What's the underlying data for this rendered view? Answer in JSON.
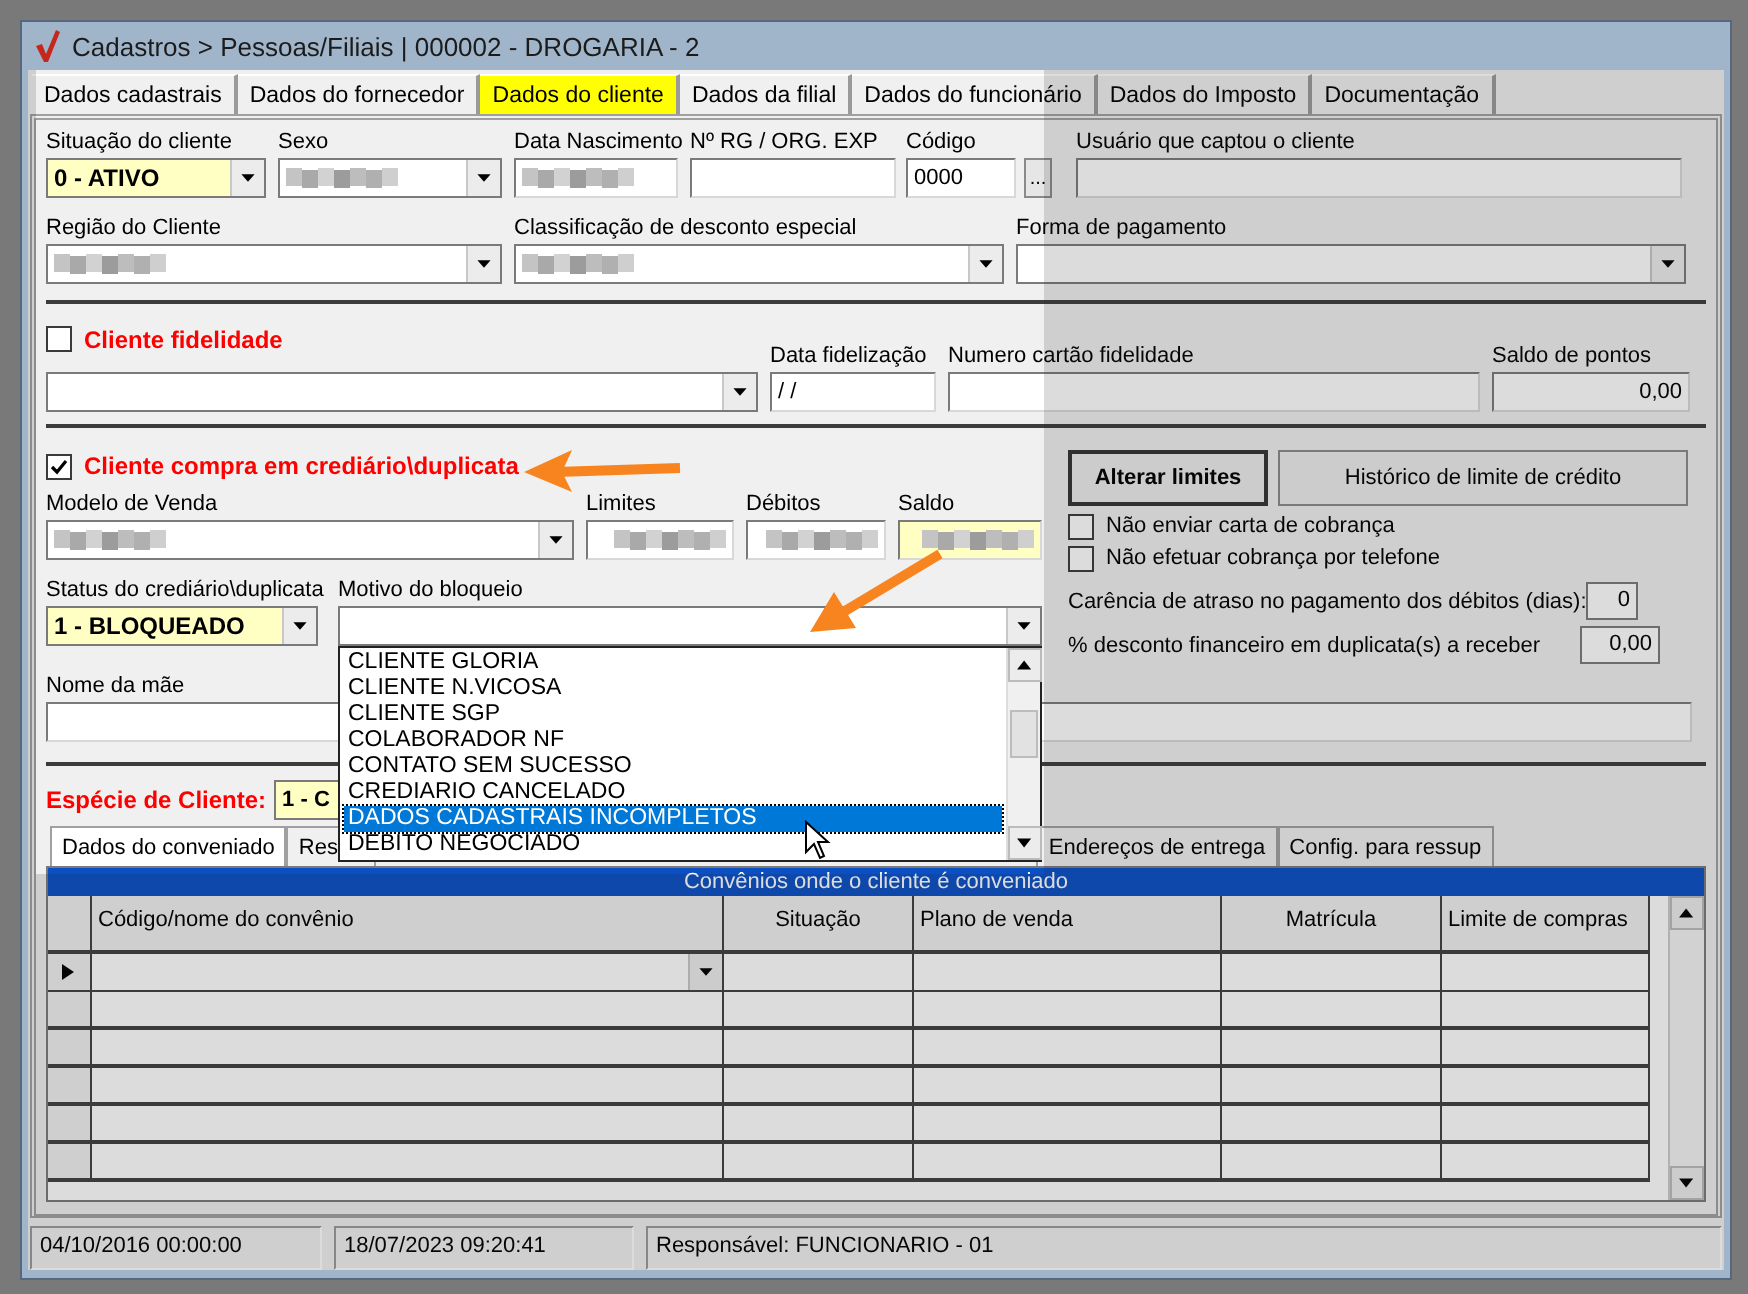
{
  "window": {
    "title": "Cadastros > Pessoas/Filiais | 000002 - DROGARIA - 2"
  },
  "tabs": [
    {
      "label": "Dados cadastrais",
      "selected": false
    },
    {
      "label": "Dados do fornecedor",
      "selected": false
    },
    {
      "label": "Dados do cliente",
      "selected": true
    },
    {
      "label": "Dados da filial",
      "selected": false
    },
    {
      "label": "Dados do funcionário",
      "selected": false
    },
    {
      "label": "Dados do Imposto",
      "selected": false
    },
    {
      "label": "Documentação",
      "selected": false
    }
  ],
  "client_rows": [
    [
      {
        "label": "Situação do cliente",
        "kind": "combo",
        "value": "0 - ATIVO",
        "highlighted": true
      },
      {
        "label": "Sexo",
        "kind": "combo",
        "redacted": true
      },
      {
        "label": "Data Nascimento",
        "kind": "text",
        "redacted": true
      },
      {
        "label": "Nº RG / ORG. EXP",
        "kind": "text"
      },
      {
        "label": "Código",
        "kind": "text",
        "value": "0000"
      },
      {
        "kind": "button",
        "value": "..."
      },
      {
        "label": "Usuário que captou o cliente",
        "kind": "text"
      }
    ],
    [
      {
        "label": "Região do Cliente",
        "kind": "combo",
        "redacted": true
      },
      {
        "label": "Classificação de desconto especial",
        "kind": "combo",
        "redacted": true
      },
      {
        "label": "Forma de pagamento",
        "kind": "combo"
      }
    ]
  ],
  "loyalty": {
    "label": "Cliente fidelidade",
    "checked": false,
    "fields": [
      {
        "kind": "combo"
      },
      {
        "label": "Data fidelização",
        "kind": "text",
        "value": "/ /"
      },
      {
        "label": "Numero cartão fidelidade",
        "kind": "text"
      },
      {
        "label": "Saldo de pontos",
        "kind": "number",
        "value": "0,00"
      }
    ]
  },
  "credit": {
    "label": "Cliente compra em crediário\\duplicata",
    "checked": true,
    "rows": [
      [
        {
          "label": "Modelo de Venda",
          "kind": "combo",
          "redacted": true
        },
        {
          "label": "Limites",
          "kind": "number",
          "redacted": true
        },
        {
          "label": "Débitos",
          "kind": "number",
          "redacted": true
        },
        {
          "label": "Saldo",
          "kind": "number",
          "redacted": true,
          "highlighted": true
        }
      ],
      [
        {
          "label": "Status do crediário\\duplicata",
          "kind": "combo",
          "value": "1 - BLOQUEADO",
          "highlighted": true
        },
        {
          "label": "Motivo do bloqueio",
          "kind": "combo"
        }
      ]
    ],
    "buttons": [
      {
        "label": "Alterar limites",
        "default": true
      },
      {
        "label": "Histórico de limite de crédito",
        "default": false
      }
    ],
    "options": [
      {
        "label": "Não enviar carta de cobrança",
        "checked": false
      },
      {
        "label": "Não efetuar cobrança por telefone",
        "checked": false
      }
    ],
    "settings": [
      {
        "label": "Carência de atraso no pagamento dos débitos (dias):",
        "value": "0"
      },
      {
        "label": "% desconto financeiro em duplicata(s) a receber",
        "value": "0,00"
      }
    ]
  },
  "mother_name": {
    "label": "Nome da mãe"
  },
  "client_type": {
    "label": "Espécie de Cliente:",
    "value": "1 - C"
  },
  "block_reasons": [
    {
      "label": "CLIENTE GLORIA",
      "selected": false
    },
    {
      "label": "CLIENTE N.VICOSA",
      "selected": false
    },
    {
      "label": "CLIENTE SGP",
      "selected": false
    },
    {
      "label": "COLABORADOR NF",
      "selected": false
    },
    {
      "label": "CONTATO SEM SUCESSO",
      "selected": false
    },
    {
      "label": "CREDIARIO CANCELADO",
      "selected": false
    },
    {
      "label": "DADOS CADASTRAIS INCOMPLETOS",
      "selected": true
    },
    {
      "label": "DEBITO NEGOCIADO",
      "selected": false
    }
  ],
  "sub_tabs": [
    {
      "label": "Dados do conveniado",
      "selected": true
    },
    {
      "label": "Res",
      "selected": false
    },
    {
      "label": "Endereços de entrega",
      "selected": false
    },
    {
      "label": "Config. para ressup",
      "selected": false
    }
  ],
  "grid": {
    "title": "Convênios onde o cliente é conveniado",
    "columns": [
      "Código/nome do convênio",
      "Situação",
      "Plano de venda",
      "Matrícula",
      "Limite de compras"
    ],
    "rows": [
      {
        "current": true
      },
      {
        "current": false
      },
      {
        "current": false
      },
      {
        "current": false
      },
      {
        "current": false
      },
      {
        "current": false
      }
    ]
  },
  "status_bar": [
    "04/10/2016 00:00:00",
    "18/07/2023 09:20:41",
    "Responsável: FUNCIONARIO - 01"
  ]
}
